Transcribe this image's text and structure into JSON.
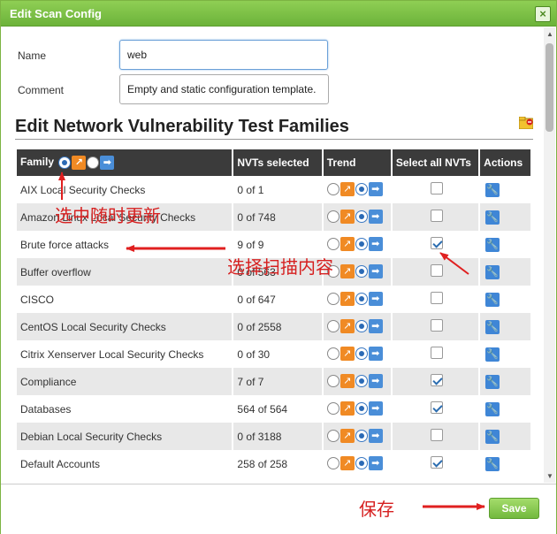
{
  "dialog": {
    "title": "Edit Scan Config",
    "close_label": "×"
  },
  "form": {
    "name_label": "Name",
    "name_value": "web",
    "comment_label": "Comment",
    "comment_value": "Empty and static configuration template."
  },
  "section": {
    "title": "Edit Network Vulnerability Test Families"
  },
  "table": {
    "headers": {
      "family": "Family",
      "nvts_selected": "NVTs selected",
      "trend": "Trend",
      "select_all": "Select all NVTs",
      "actions": "Actions"
    },
    "rows": [
      {
        "family": "AIX Local Security Checks",
        "nvts": "0 of 1",
        "checked": false,
        "trend": "static"
      },
      {
        "family": "Amazon Linux Local Security Checks",
        "nvts": "0 of 748",
        "checked": false,
        "trend": "static"
      },
      {
        "family": "Brute force attacks",
        "nvts": "9 of 9",
        "checked": true,
        "trend": "static"
      },
      {
        "family": "Buffer overflow",
        "nvts": "0 of 563",
        "checked": false,
        "trend": "static"
      },
      {
        "family": "CISCO",
        "nvts": "0 of 647",
        "checked": false,
        "trend": "static"
      },
      {
        "family": "CentOS Local Security Checks",
        "nvts": "0 of 2558",
        "checked": false,
        "trend": "static"
      },
      {
        "family": "Citrix Xenserver Local Security Checks",
        "nvts": "0 of 30",
        "checked": false,
        "trend": "static"
      },
      {
        "family": "Compliance",
        "nvts": "7 of 7",
        "checked": true,
        "trend": "static"
      },
      {
        "family": "Databases",
        "nvts": "564 of 564",
        "checked": true,
        "trend": "static"
      },
      {
        "family": "Debian Local Security Checks",
        "nvts": "0 of 3188",
        "checked": false,
        "trend": "static"
      },
      {
        "family": "Default Accounts",
        "nvts": "258 of 258",
        "checked": true,
        "trend": "static"
      }
    ]
  },
  "footer": {
    "save_label": "Save"
  },
  "annotations": {
    "select_update": "选中随时更新",
    "select_scan": "选择扫描内容",
    "save_note": "保存"
  },
  "colors": {
    "titlebar": "#6cb33a",
    "header_bg": "#3b3b3b",
    "annotation": "#d62020",
    "trend_up": "#f08a24",
    "trend_right": "#4a8ed8"
  }
}
